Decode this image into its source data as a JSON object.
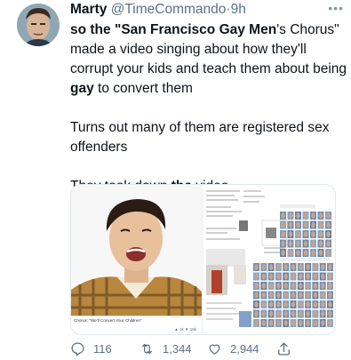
{
  "tweet": {
    "display_name": "Marty",
    "handle": "@TimeCommando",
    "separator": "·",
    "time": "9h",
    "more_icon": "more-options-icon",
    "text": {
      "p1": {
        "a": "so the \"",
        "b": "San Francisco Gay Men",
        "c": "'s Chorus\" made a video singing about how they'll corrupt your kids and teach them about being ",
        "d": "gay",
        "e": " to convert them"
      },
      "p2": "Turns out many of them are registered sex offenders",
      "p3": {
        "a": "They took down ",
        "b": "the",
        "c": " video"
      }
    },
    "media": {
      "video_caption": "Chorus: \"We'll Convert Your Children\"",
      "video_likes": "1k",
      "video_dislikes": "18k"
    },
    "actions": {
      "reply": {
        "icon": "reply-icon",
        "count": "116"
      },
      "retweet": {
        "icon": "retweet-icon",
        "count": "1,344"
      },
      "like": {
        "icon": "heart-icon",
        "count": "2,944"
      },
      "share": {
        "icon": "share-icon"
      }
    }
  }
}
